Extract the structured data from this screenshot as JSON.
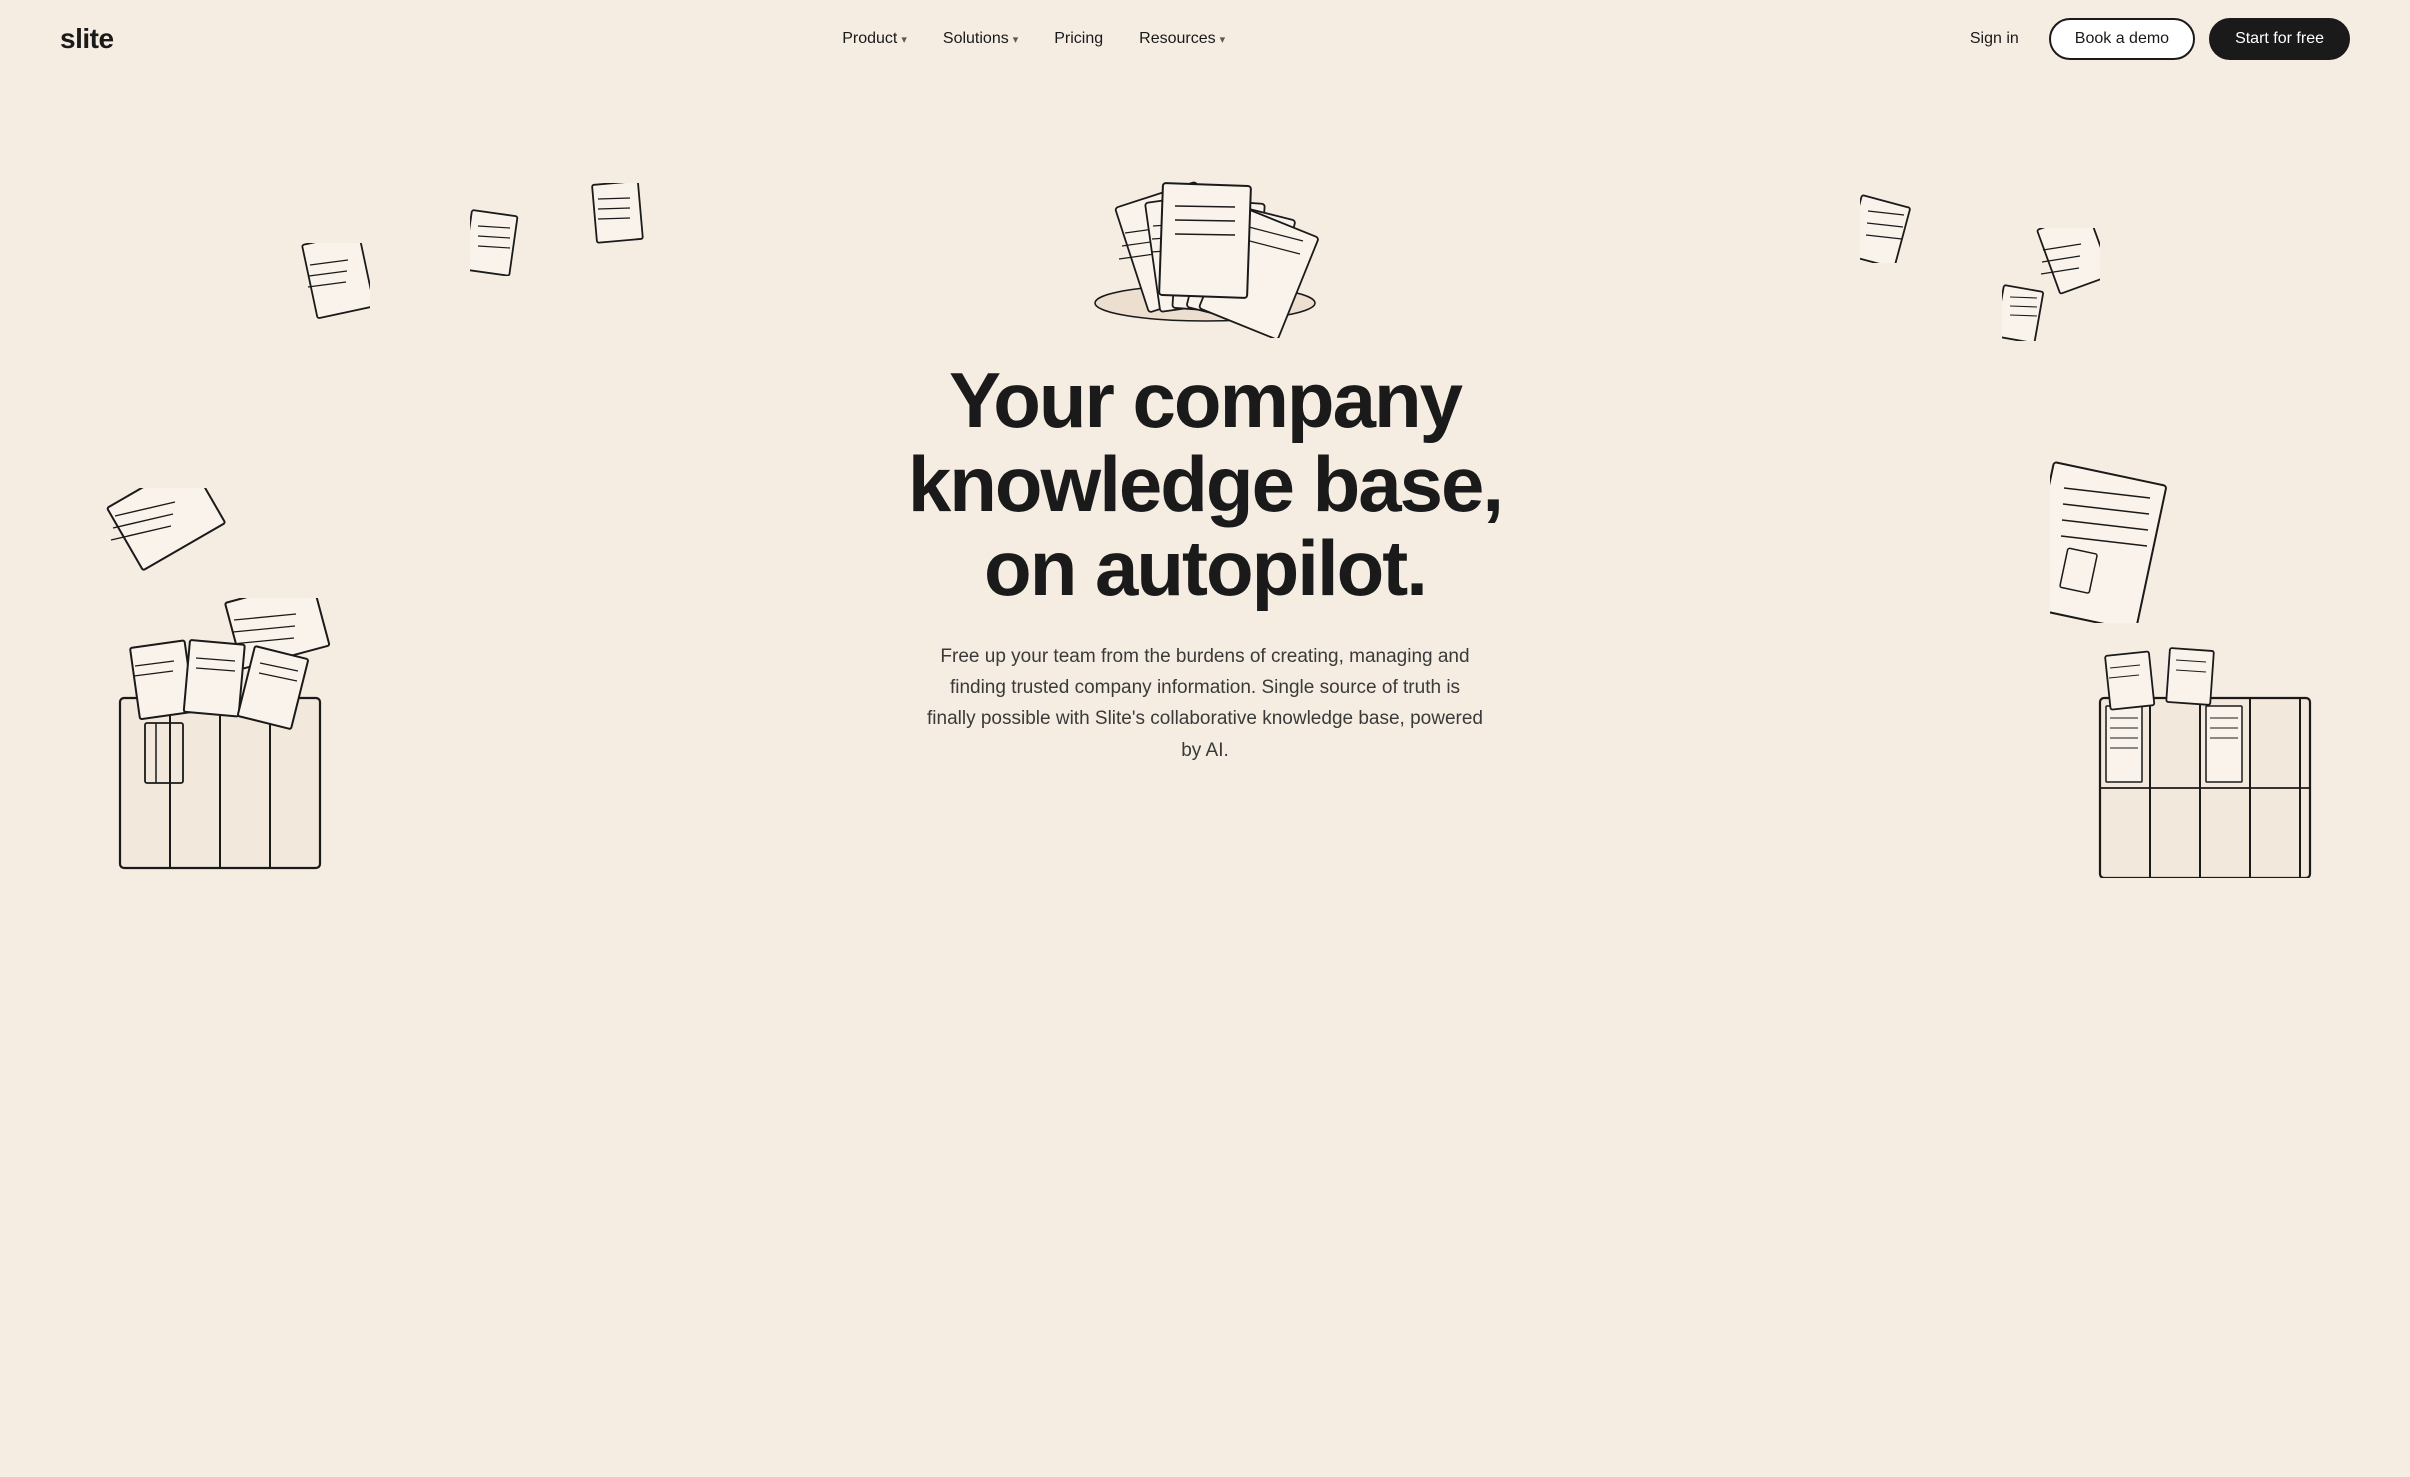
{
  "brand": {
    "logo": "slite"
  },
  "nav": {
    "links": [
      {
        "label": "Product",
        "has_dropdown": true
      },
      {
        "label": "Solutions",
        "has_dropdown": true
      },
      {
        "label": "Pricing",
        "has_dropdown": false
      },
      {
        "label": "Resources",
        "has_dropdown": true
      }
    ],
    "signin_label": "Sign in",
    "book_demo_label": "Book a demo",
    "start_free_label": "Start for free"
  },
  "hero": {
    "title_line1": "Your company",
    "title_line2": "knowledge base,",
    "title_line3": "on autopilot.",
    "subtitle": "Free up your team from the burdens of creating, managing and finding trusted company information. Single source of truth is finally possible with Slite's collaborative knowledge base, powered by AI."
  },
  "colors": {
    "background": "#f5ece2",
    "text_dark": "#1a1a1a",
    "text_medium": "#3a3a3a",
    "btn_outline_bg": "#ffffff",
    "btn_filled_bg": "#1a1a1a",
    "btn_filled_text": "#ffffff"
  }
}
